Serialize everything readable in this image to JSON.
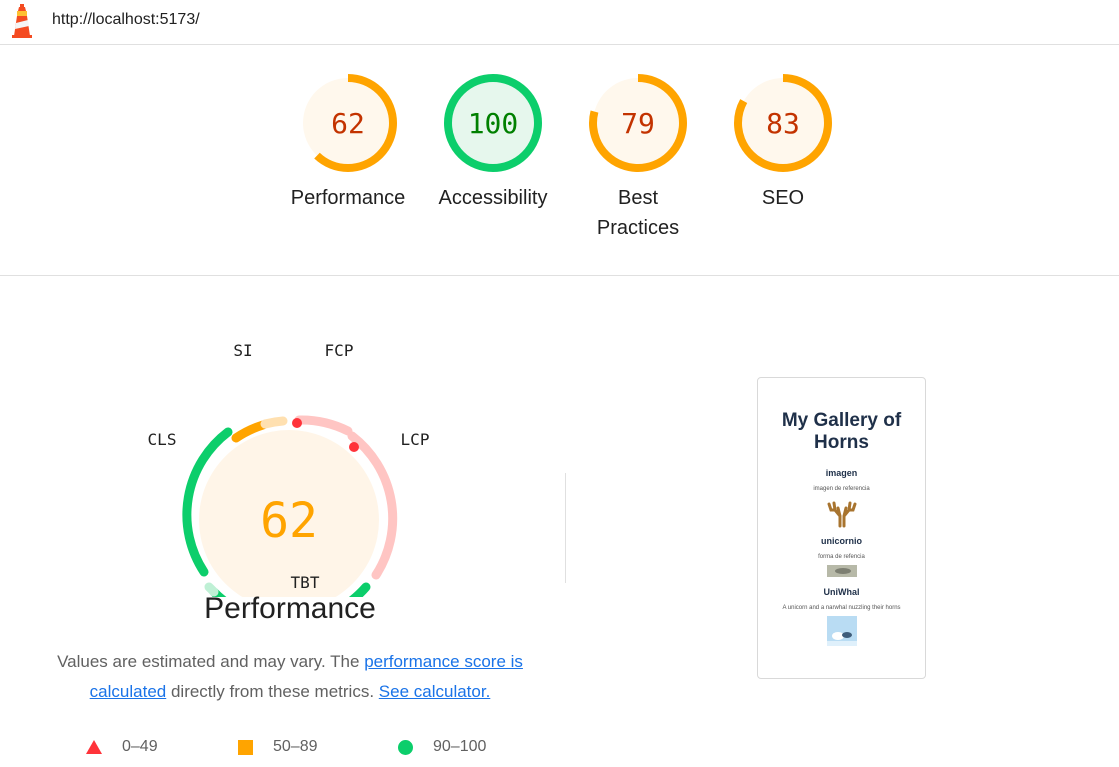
{
  "header": {
    "url": "http://localhost:5173/"
  },
  "categories": [
    {
      "score": "62",
      "label": "Performance",
      "level": "average"
    },
    {
      "score": "100",
      "label": "Accessibility",
      "level": "pass"
    },
    {
      "score": "79",
      "label": "Best Practices",
      "level": "average"
    },
    {
      "score": "83",
      "label": "SEO",
      "level": "average"
    }
  ],
  "performance": {
    "score": "62",
    "title": "Performance",
    "metrics": {
      "si": "SI",
      "fcp": "FCP",
      "lcp": "LCP",
      "tbt": "TBT",
      "cls": "CLS"
    },
    "description": {
      "before": "Values are estimated and may vary. The ",
      "link": "performance score is calculated",
      "middle": " directly from these metrics. ",
      "calc_link": "See calculator."
    },
    "legend": {
      "fail": "0–49",
      "average": "50–89",
      "pass": "90–100"
    }
  },
  "screenshot": {
    "title": "My Gallery of Horns",
    "items": [
      {
        "heading": "imagen",
        "caption": "imagen de referencia"
      },
      {
        "heading": "unicornio",
        "caption": "forma de refencia"
      },
      {
        "heading": "UniWhal",
        "caption": "A unicorn and a narwhal nuzzling their horns"
      }
    ]
  },
  "colors": {
    "pass": "#0cce6b",
    "average": "#ffa400",
    "fail": "#ff4e42",
    "average_text": "#c33300",
    "pass_text": "#008000",
    "link": "#1a73e8"
  }
}
